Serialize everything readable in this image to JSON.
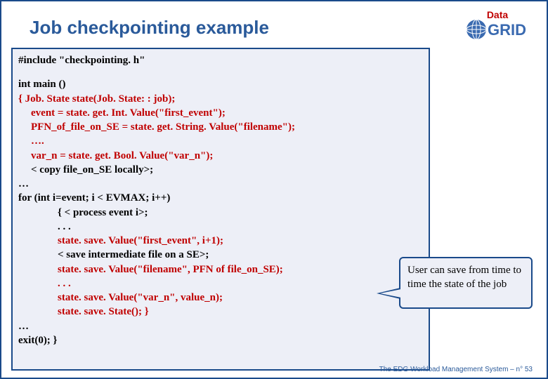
{
  "title": "Job checkpointing example",
  "logo": {
    "text1": "Data",
    "text2": "GRID"
  },
  "code": {
    "include": "#include \"checkpointing. h\"",
    "main_sig": "int main ()",
    "l1": "{ Job. State state(Job. State: : job);",
    "l2": "event = state. get. Int. Value(\"first_event\");",
    "l3": "PFN_of_file_on_SE = state. get. String. Value(\"filename\");",
    "l4": "….",
    "l5": "var_n = state. get. Bool. Value(\"var_n\");",
    "l6": "< copy file_on_SE locally>;",
    "l7": "…",
    "l8": "for (int i=event; i < EVMAX; i++)",
    "l9": "{  < process event i>;",
    "l10": ". . .",
    "l11": "state. save. Value(\"first_event\", i+1);",
    "l12": "< save intermediate file on a SE>;",
    "l13": "state. save. Value(\"filename\", PFN of file_on_SE);",
    "l14": ". . .",
    "l15": "state. save. Value(\"var_n\", value_n);",
    "l16": "state. save. State(); }",
    "l17": "…",
    "l18": "exit(0); }"
  },
  "callout": "User can save from time to time the state of the job",
  "footer": {
    "text": "The EDG Workload Management System –",
    "page_prefix": "n°",
    "page": "53"
  }
}
